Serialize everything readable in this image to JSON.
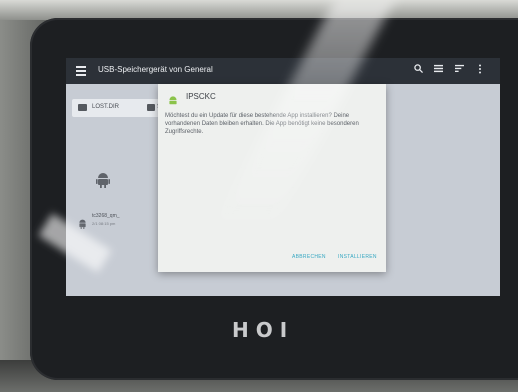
{
  "appbar": {
    "menu_icon": "menu-icon",
    "title": "USB-Speichergerät von General",
    "icons": [
      "search-icon",
      "list-view-icon",
      "sort-icon",
      "more-icon"
    ]
  },
  "sidebar": {
    "folder_label": "LOST.DIR",
    "folder2_label": "S",
    "apk_name": "tc3268_qm_",
    "apk_meta": "2/1 08:15 pm"
  },
  "dialog": {
    "title": "IPSCKC",
    "message": "Möchtest du ein Update für diese bestehende App installieren? Deine vorhandenen Daten bleiben erhalten. Die App benötigt keine besonderen Zugriffsrechte.",
    "cancel_label": "ABBRECHEN",
    "install_label": "INSTALLIEREN"
  },
  "device": {
    "brand": "HOI"
  },
  "colors": {
    "appbar": "#2c3138",
    "screen": "#c7ccd4",
    "dialog": "#eef0ee",
    "accent": "#36a7c2"
  }
}
